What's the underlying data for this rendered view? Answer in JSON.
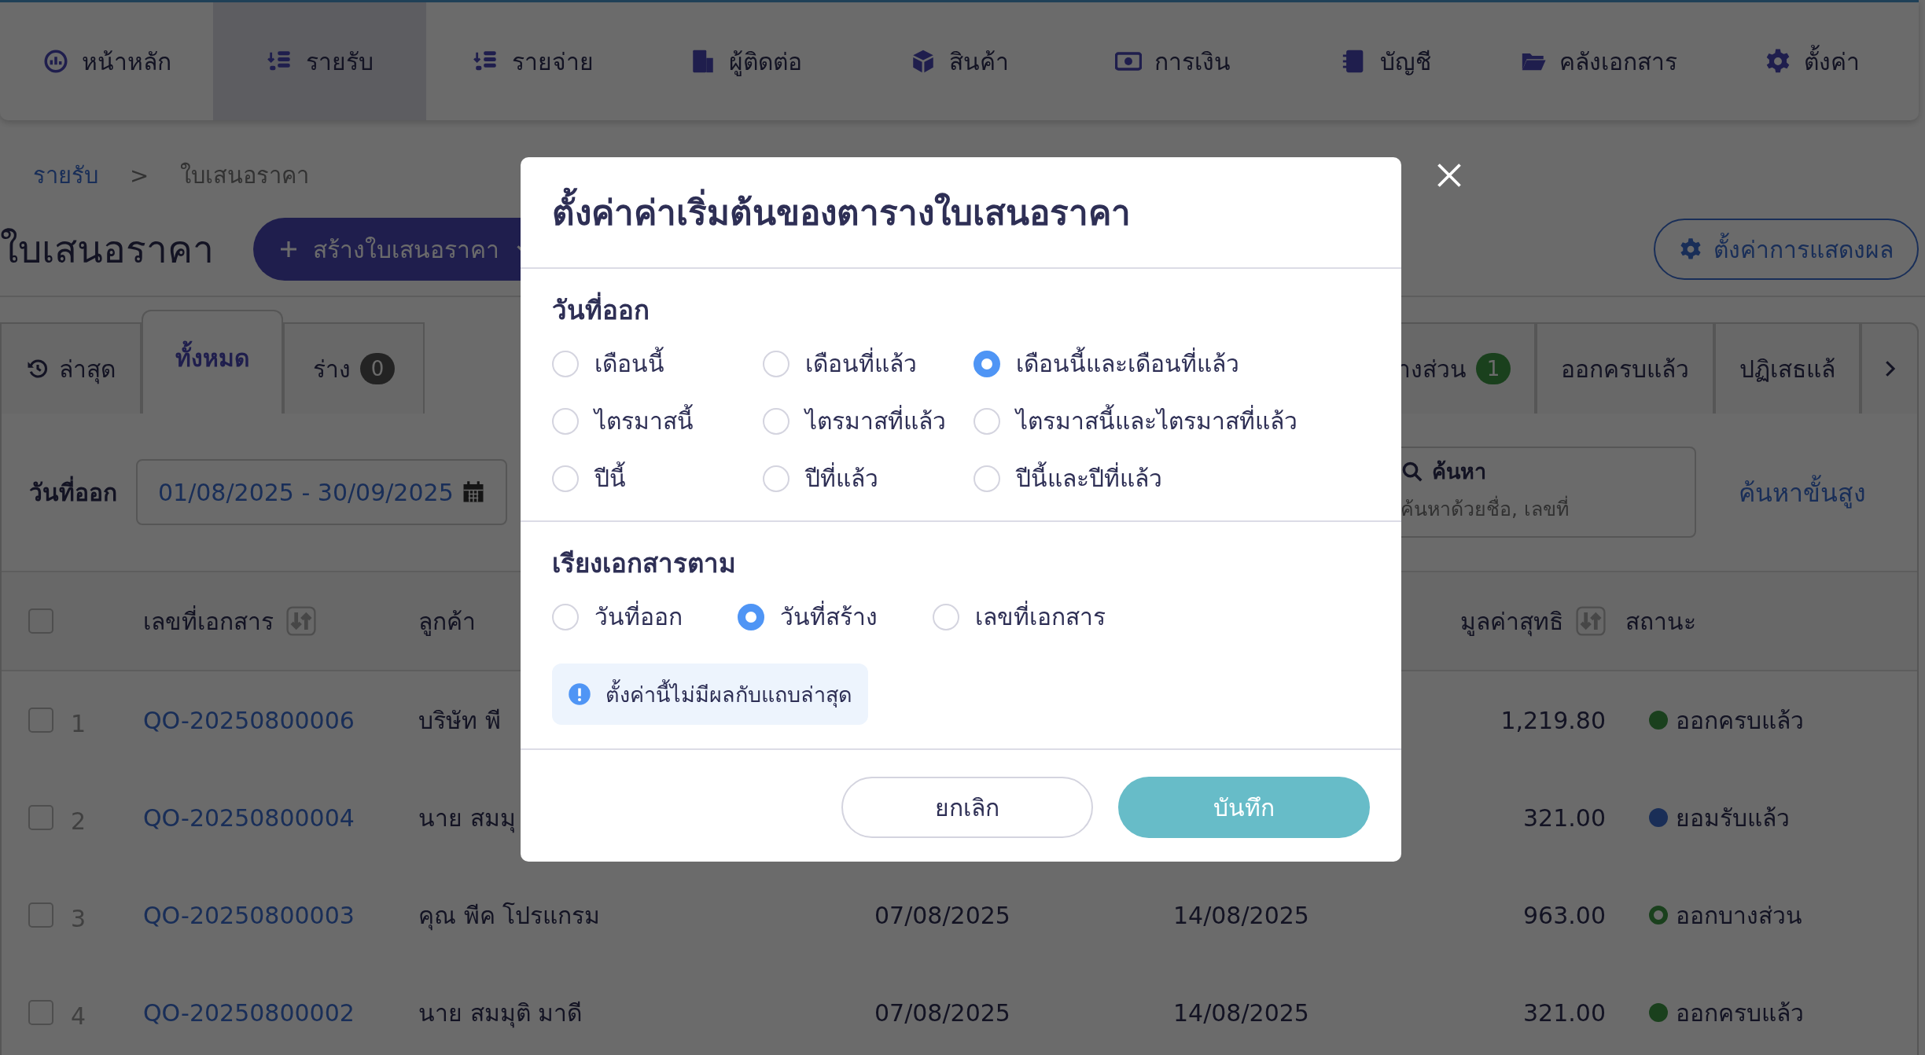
{
  "nav": [
    {
      "label": "หน้าหลัก",
      "selected": false
    },
    {
      "label": "รายรับ",
      "selected": true
    },
    {
      "label": "รายจ่าย",
      "selected": false
    },
    {
      "label": "ผู้ติดต่อ",
      "selected": false
    },
    {
      "label": "สินค้า",
      "selected": false
    },
    {
      "label": "การเงิน",
      "selected": false
    },
    {
      "label": "บัญชี",
      "selected": false
    },
    {
      "label": "คลังเอกสาร",
      "selected": false
    },
    {
      "label": "ตั้งค่า",
      "selected": false
    }
  ],
  "breadcrumb": {
    "parent": "รายรับ",
    "separator": ">",
    "current": "ใบเสนอราคา"
  },
  "page_title": "ใบเสนอราคา",
  "create_button": "สร้างใบเสนอราคา",
  "display_settings_button": "ตั้งค่าการแสดงผล",
  "tabs_left": [
    {
      "label": "ล่าสุด",
      "selected": false
    },
    {
      "label": "ทั้งหมด",
      "selected": true
    },
    {
      "label": "ร่าง",
      "badge": "0",
      "kind": "draft",
      "selected": false
    }
  ],
  "tabs_right": [
    {
      "label": "างส่วน",
      "badge": "1",
      "kind": "partial",
      "selected": false
    },
    {
      "label": "ออกครบแล้ว",
      "selected": false
    },
    {
      "label": "ปฏิเสธแล้",
      "selected": false
    }
  ],
  "filters": {
    "date_label": "วันที่ออก",
    "date_range": "01/08/2025 - 30/09/2025",
    "search_label": "ค้นหา",
    "search_placeholder": "ค้นหาด้วยชื่อ, เลขที่",
    "advanced_search": "ค้นหาขั้นสูง"
  },
  "table": {
    "select_all_checked": false,
    "columns": [
      {
        "label": "เลขที่เอกสาร",
        "sortable": true
      },
      {
        "label": "ลูกค้า",
        "sortable": false
      },
      {
        "label": "มูลค่าสุทธิ",
        "sortable": true
      },
      {
        "label": "สถานะ",
        "sortable": false
      }
    ],
    "rows": [
      {
        "checked": false,
        "number": "1",
        "doc_no": "QO-20250800006",
        "customer": "บริษัท พี",
        "amount": "1,219.80",
        "status": "ออกครบแล้ว",
        "kind": "complete"
      },
      {
        "checked": false,
        "number": "2",
        "doc_no": "QO-20250800004",
        "customer": "นาย สมมุ",
        "amount": "321.00",
        "status": "ยอมรับแล้ว",
        "kind": "accepted"
      },
      {
        "checked": false,
        "number": "3",
        "doc_no": "QO-20250800003",
        "customer": "คุณ พีค โปรแกรม",
        "issue_date": "07/08/2025",
        "due_date": "14/08/2025",
        "amount": "963.00",
        "status": "ออกบางส่วน",
        "kind": "partial"
      },
      {
        "checked": false,
        "number": "4",
        "doc_no": "QO-20250800002",
        "customer": "นาย สมมุติ มาดี",
        "issue_date": "07/08/2025",
        "due_date": "14/08/2025",
        "amount": "321.00",
        "status": "ออกครบแล้ว",
        "kind": "complete"
      }
    ]
  },
  "modal": {
    "title": "ตั้งค่าค่าเริ่มต้นของตารางใบเสนอราคา",
    "sections": [
      {
        "title": "วันที่ออก",
        "kind": "grid",
        "options": [
          {
            "label": "เดือนนี้",
            "selected": false
          },
          {
            "label": "เดือนที่แล้ว",
            "selected": false
          },
          {
            "label": "เดือนนี้และเดือนที่แล้ว",
            "selected": true
          },
          {
            "label": "ไตรมาสนี้",
            "selected": false
          },
          {
            "label": "ไตรมาสที่แล้ว",
            "selected": false
          },
          {
            "label": "ไตรมาสนี้และไตรมาสที่แล้ว",
            "selected": false
          },
          {
            "label": "ปีนี้",
            "selected": false
          },
          {
            "label": "ปีที่แล้ว",
            "selected": false
          },
          {
            "label": "ปีนี้และปีที่แล้ว",
            "selected": false
          }
        ]
      },
      {
        "title": "เรียงเอกสารตาม",
        "kind": "row",
        "options": [
          {
            "label": "วันที่ออก",
            "selected": false
          },
          {
            "label": "วันที่สร้าง",
            "selected": true
          },
          {
            "label": "เลขที่เอกสาร",
            "selected": false
          }
        ],
        "note": "ตั้งค่านี้ไม่มีผลกับแถบล่าสุด"
      }
    ],
    "buttons": [
      {
        "label": "ยกเลิก",
        "kind": "secondary"
      },
      {
        "label": "บันทึก",
        "kind": "primary"
      }
    ]
  }
}
